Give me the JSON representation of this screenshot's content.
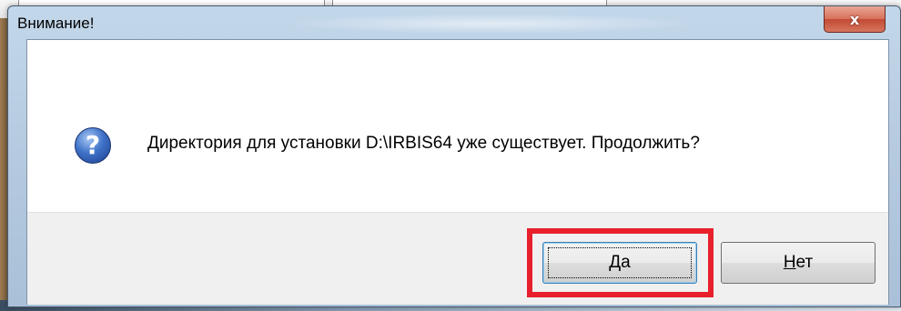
{
  "dialog": {
    "title": "Внимание!",
    "close_symbol": "x",
    "icon": "question-icon",
    "message": "Директория для установки D:\\IRBIS64 уже существует. Продолжить?",
    "buttons": {
      "yes": {
        "mnemonic": "Д",
        "rest": "а"
      },
      "no": {
        "mnemonic": "Н",
        "rest": "ет"
      }
    }
  },
  "annotation": {
    "highlight_color": "#e8202c"
  }
}
